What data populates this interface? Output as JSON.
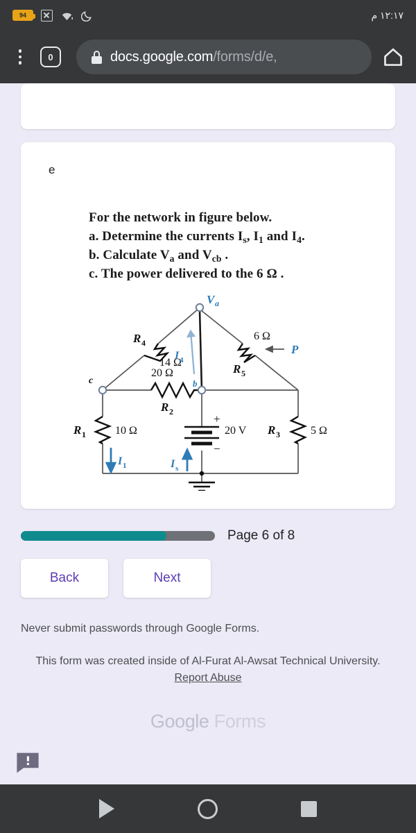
{
  "status_bar": {
    "battery_percent": "94",
    "icons": [
      "battery-icon",
      "no-sim-icon",
      "wifi-icon",
      "do-not-disturb-moon-icon"
    ],
    "time": "١٢:١٧ م"
  },
  "browser": {
    "menu_icon": "kebab-menu-icon",
    "tab_count": "0",
    "lock_icon": "lock-icon",
    "url_host": "docs.google.com",
    "url_path": "/forms/d/e,",
    "home_icon": "home-icon"
  },
  "form": {
    "section_label": "e",
    "question": {
      "line1": "For the network in figure below.",
      "line2_pre": "a. Determine the currents I",
      "line2_sub1": "s",
      "line2_mid": ", I",
      "line2_sub2": "1",
      "line2_post": " and I",
      "line2_sub3": "4",
      "line2_end": ".",
      "line3_pre": "b. Calculate V",
      "line3_sub1": "a",
      "line3_mid": " and V",
      "line3_sub2": "cb",
      "line3_end": " .",
      "line4": "c. The power delivered to the 6 Ω ."
    },
    "figure": {
      "title": "circuit-schematic",
      "nodes": {
        "top": "Va",
        "left": "c",
        "middle": "b"
      },
      "components": [
        {
          "id": "R4",
          "value": "14 Ω"
        },
        {
          "id": "R5",
          "value": "6 Ω"
        },
        {
          "id": "R2",
          "value": "20 Ω"
        },
        {
          "id": "R1",
          "value": "10 Ω"
        },
        {
          "id": "R3",
          "value": "5 Ω"
        },
        {
          "id": "source",
          "value": "20 V"
        }
      ],
      "currents": [
        "I4",
        "I1",
        "Is"
      ],
      "power_label": "P",
      "ground": "ground-symbol"
    },
    "progress": {
      "page_label": "Page 6 of 8",
      "fill_percent": 75,
      "fill_color": "#0F8B8D",
      "track_color": "#6E7175"
    },
    "nav": {
      "back_label": "Back",
      "next_label": "Next"
    },
    "footer": {
      "warning": "Never submit passwords through Google Forms.",
      "created_text": "This form was created inside of Al-Furat Al-Awsat Technical University.",
      "report_link": "Report Abuse",
      "logo_part1": "Google",
      "logo_part2": " Forms"
    },
    "feedback_icon": "feedback-bubble-icon"
  },
  "android_nav": {
    "back_icon": "back-triangle-icon",
    "home_icon": "home-circle-icon",
    "recents_icon": "recents-square-icon"
  }
}
